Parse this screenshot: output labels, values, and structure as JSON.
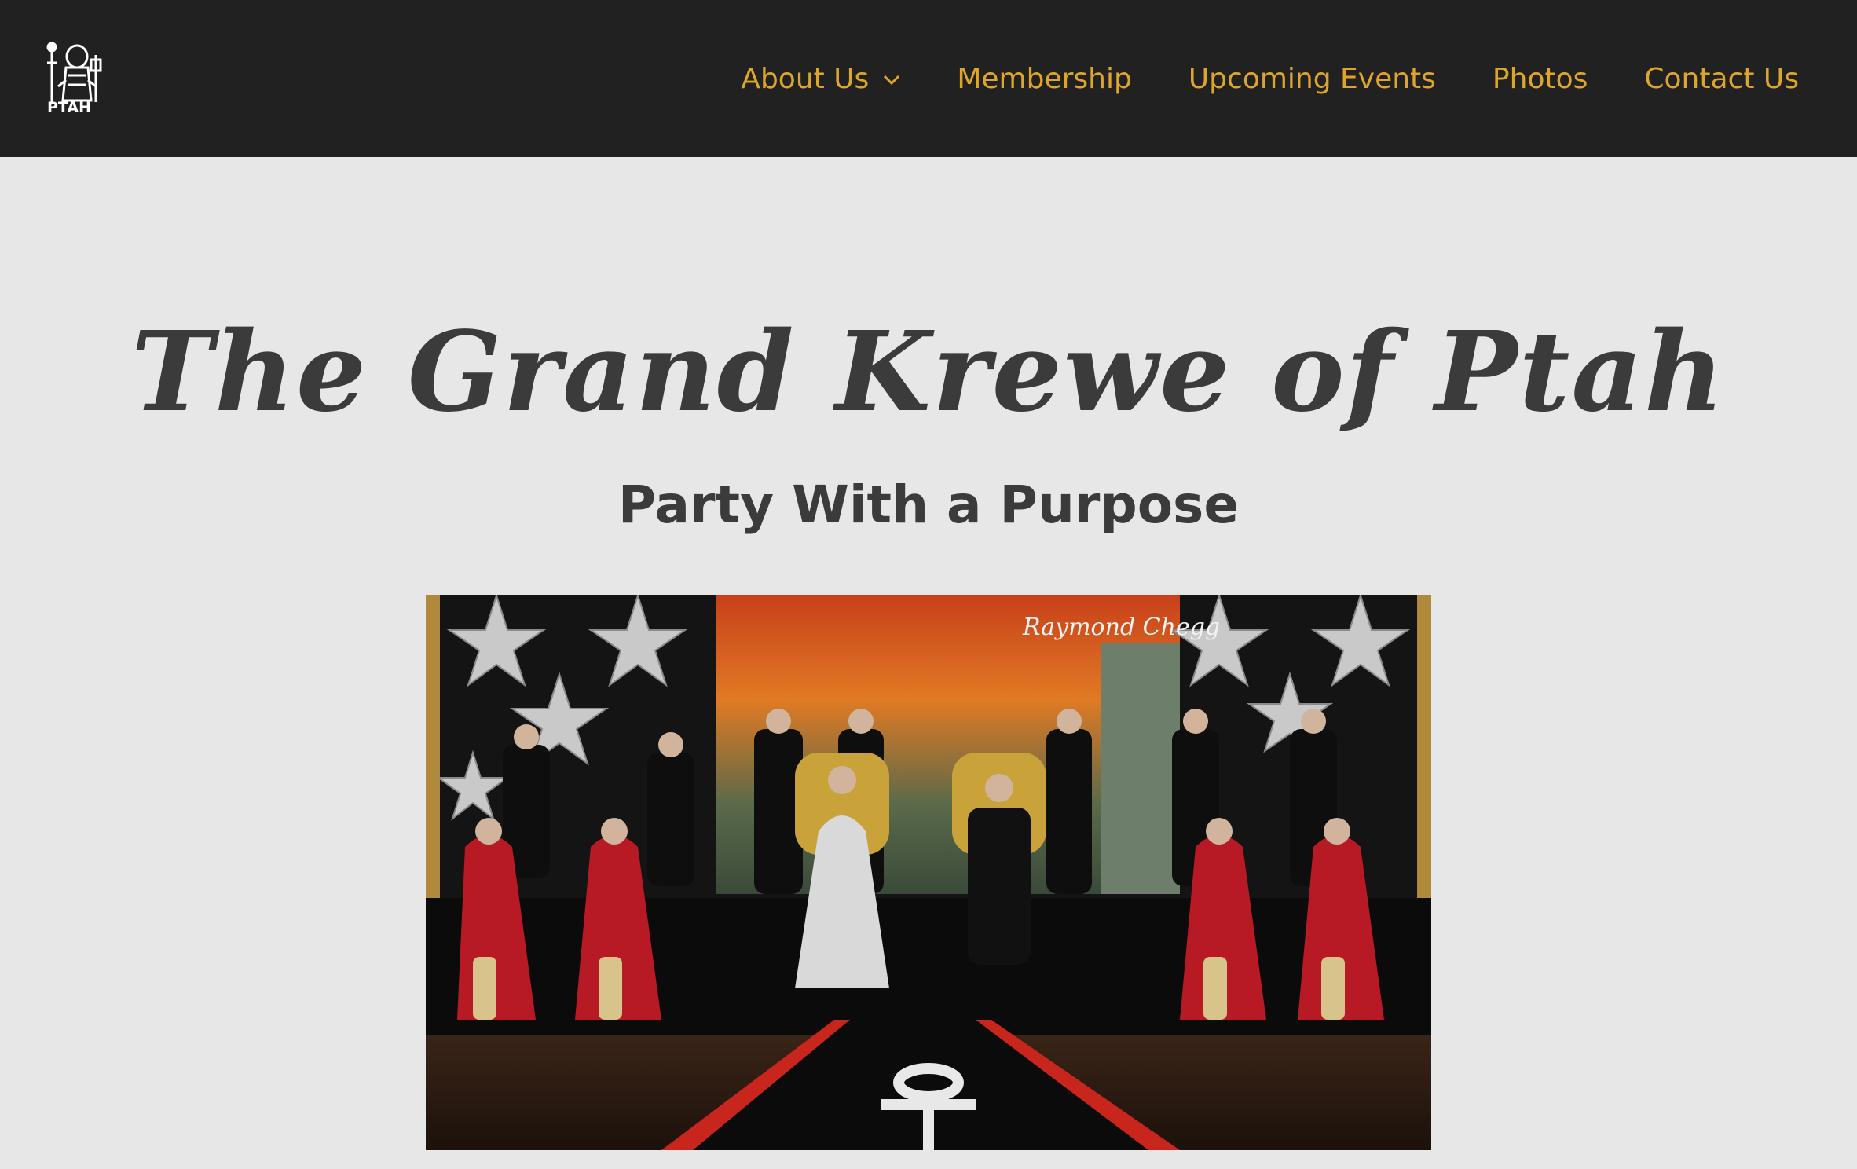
{
  "header": {
    "logo_text": "PTAH",
    "nav": [
      {
        "label": "About Us",
        "has_dropdown": true
      },
      {
        "label": "Membership",
        "has_dropdown": false
      },
      {
        "label": "Upcoming Events",
        "has_dropdown": false
      },
      {
        "label": "Photos",
        "has_dropdown": false
      },
      {
        "label": "Contact Us",
        "has_dropdown": false
      }
    ]
  },
  "hero": {
    "title": "The Grand Krewe of Ptah",
    "subtitle": "Party With a Purpose",
    "photo_watermark": "Raymond Chegg"
  },
  "colors": {
    "header_bg": "#212121",
    "nav_text": "#dda62b",
    "page_bg": "#e7e7e7",
    "heading": "#3b3b3b"
  }
}
